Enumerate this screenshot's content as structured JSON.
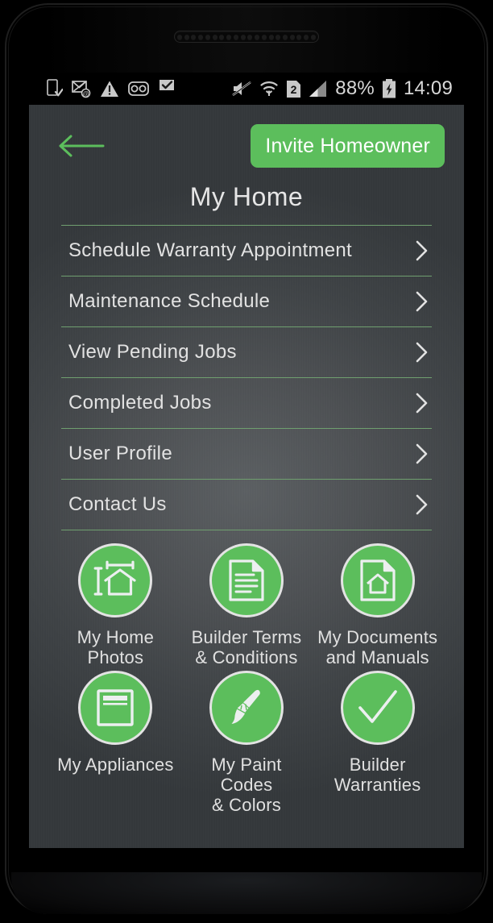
{
  "status_bar": {
    "left_icons": [
      {
        "name": "app-install-icon",
        "label": "install"
      },
      {
        "name": "email-at-icon",
        "label": "email"
      },
      {
        "name": "warning-triangle-icon",
        "label": "warning"
      },
      {
        "name": "voicemail-icon",
        "label": "voicemail"
      },
      {
        "name": "flag-check-icon",
        "label": "task"
      }
    ],
    "right_icons": [
      {
        "name": "mute-icon",
        "label": "silent"
      },
      {
        "name": "wifi-icon",
        "label": "wifi"
      },
      {
        "name": "sim-2-icon",
        "label": "2"
      },
      {
        "name": "signal-bars-icon",
        "label": "signal"
      }
    ],
    "battery_percent": "88%",
    "battery_icon": "battery-charging-icon",
    "clock": "14:09"
  },
  "header": {
    "back_icon": "back-arrow-icon",
    "invite_label": "Invite Homeowner",
    "title": "My Home"
  },
  "menu": {
    "items": [
      {
        "label": "Schedule Warranty Appointment",
        "chevron": "chevron-right-icon"
      },
      {
        "label": "Maintenance Schedule",
        "chevron": "chevron-right-icon"
      },
      {
        "label": "View Pending Jobs",
        "chevron": "chevron-right-icon"
      },
      {
        "label": "Completed Jobs",
        "chevron": "chevron-right-icon"
      },
      {
        "label": "User Profile",
        "chevron": "chevron-right-icon"
      },
      {
        "label": "Contact Us",
        "chevron": "chevron-right-icon"
      }
    ]
  },
  "grid": {
    "tiles": [
      {
        "label": "My Home\nPhotos",
        "icon": "house-measure-icon"
      },
      {
        "label": "Builder Terms\n& Conditions",
        "icon": "document-lines-icon"
      },
      {
        "label": "My Documents\nand Manuals",
        "icon": "document-house-icon"
      },
      {
        "label": "My Appliances",
        "icon": "appliance-window-icon"
      },
      {
        "label": "My Paint\nCodes\n& Colors",
        "icon": "paint-brush-icon"
      },
      {
        "label": "Builder\nWarranties",
        "icon": "checkmark-icon"
      }
    ]
  },
  "colors": {
    "accent_green": "#5cbe5c",
    "divider_green": "#6f9f6f",
    "text_light": "#e2e2e2",
    "screen_bg": "#4d5053"
  }
}
